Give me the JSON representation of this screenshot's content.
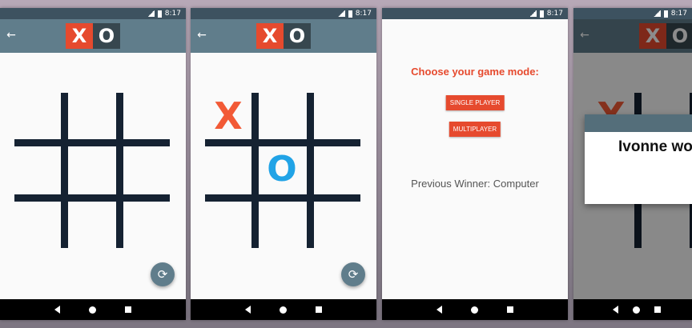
{
  "status": {
    "time": "8:17"
  },
  "logo": {
    "x": "X",
    "o": "O"
  },
  "icons": {
    "back": "←",
    "refresh": "⟳"
  },
  "screen2": {
    "marks": {
      "x": "X",
      "o": "O"
    }
  },
  "screen3": {
    "title": "Choose your game mode:",
    "single_player": "SINGLE PLAYER",
    "multiplayer": "MULTIPLAYER",
    "previous_winner": "Previous Winner: Computer"
  },
  "screen4": {
    "dialog_text": "Ivonne won"
  },
  "colors": {
    "app_bar": "#607d8b",
    "status_bar": "#3d5260",
    "accent": "#e64a2e",
    "o_mark": "#21a3e6",
    "grid": "#152232"
  }
}
